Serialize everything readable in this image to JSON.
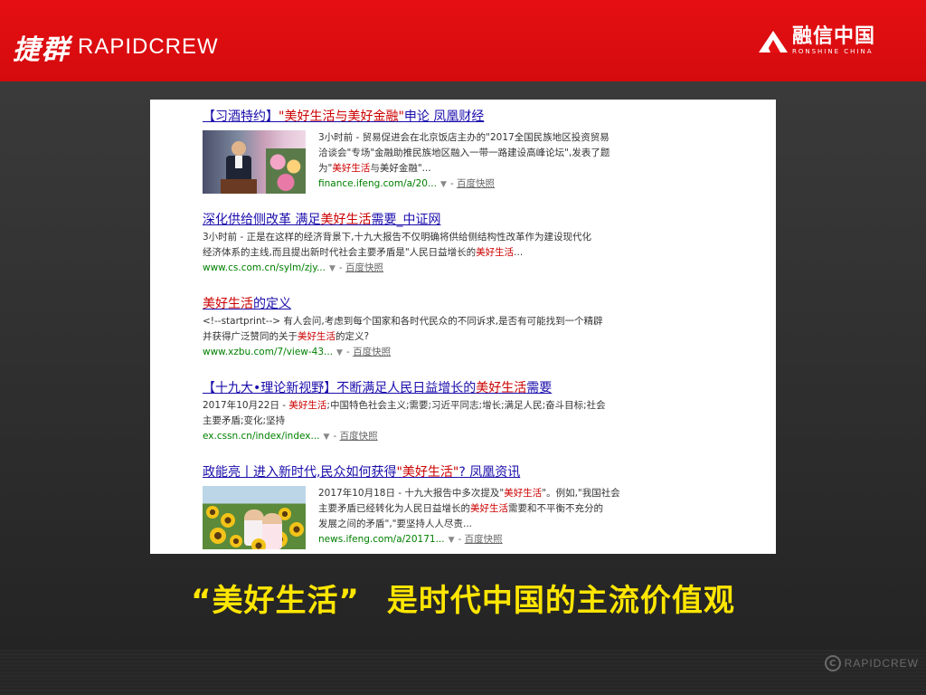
{
  "header": {
    "logo_cn": "捷群",
    "logo_en": "RAPIDCREW",
    "partner_cn": "融信中国",
    "partner_en": "RONSHINE CHINA"
  },
  "results": [
    {
      "title_parts": [
        "【习酒特约】",
        "\"美好生活与美好金融\"",
        "申论 凤凰财经"
      ],
      "text_lines": [
        [
          "3小时前 - 贸易促进会在北京饭店主办的\"2017全国民族地区投资贸易"
        ],
        [
          "洽谈会\"专场\"金融助推民族地区融入一带一路建设高峰论坛\",发表了题"
        ],
        [
          "为\"",
          "美好生活",
          "与美好金融\"..."
        ]
      ],
      "url": "finance.ifeng.com/a/20...",
      "snapshot": "百度快照"
    },
    {
      "title_parts": [
        "深化供给侧改革 满足",
        "美好生活",
        "需要_中证网"
      ],
      "text_lines": [
        [
          "3小时前 - 正是在这样的经济背景下,十九大报告不仅明确将供给侧结构性改革作为建设现代化"
        ],
        [
          "经济体系的主线,而且提出新时代社会主要矛盾是\"人民日益增长的",
          "美好生活",
          "..."
        ]
      ],
      "url": "www.cs.com.cn/sylm/zjy...",
      "snapshot": "百度快照"
    },
    {
      "title_parts": [
        "",
        "美好生活",
        "的定义"
      ],
      "text_lines": [
        [
          "<!--startprint--> 有人会问,考虑到每个国家和各时代民众的不同诉求,是否有可能找到一个精辟"
        ],
        [
          "并获得广泛赞同的关于",
          "美好生活",
          "的定义?"
        ]
      ],
      "url": "www.xzbu.com/7/view-43...",
      "snapshot": "百度快照"
    },
    {
      "title_parts": [
        "【十九大•理论新视野】不断满足人民日益增长的",
        "美好生活",
        "需要"
      ],
      "text_lines": [
        [
          "2017年10月22日 - ",
          "美好生活",
          ";中国特色社会主义;需要;习近平同志;增长;满足人民;奋斗目标;社会"
        ],
        [
          "主要矛盾;变化;坚持"
        ]
      ],
      "url": "ex.cssn.cn/index/index...",
      "snapshot": "百度快照"
    },
    {
      "title_parts": [
        "政能亮丨进入新时代,民众如何获得",
        "\"美好生活\"",
        "? 凤凰资讯"
      ],
      "text_lines": [
        [
          "2017年10月18日 - 十九大报告中多次提及\"",
          "美好生活",
          "\"。例如,\"我国社会"
        ],
        [
          "主要矛盾已经转化为人民日益增长的",
          "美好生活",
          "需要和不平衡不充分的"
        ],
        [
          "发展之间的矛盾\",\"要坚持人人尽责..."
        ]
      ],
      "url": "news.ifeng.com/a/20171...",
      "snapshot": "百度快照"
    }
  ],
  "caption": {
    "quoted": "“美好生活”",
    "rest": "是时代中国的主流价值观"
  },
  "watermark": {
    "symbol": "C",
    "text": "RAPIDCREW"
  },
  "colors": {
    "header_red": "#e50f12",
    "link_blue": "#1a0dab",
    "highlight_red": "#cc0000",
    "url_green": "#008000",
    "caption_yellow": "#ffe600"
  }
}
